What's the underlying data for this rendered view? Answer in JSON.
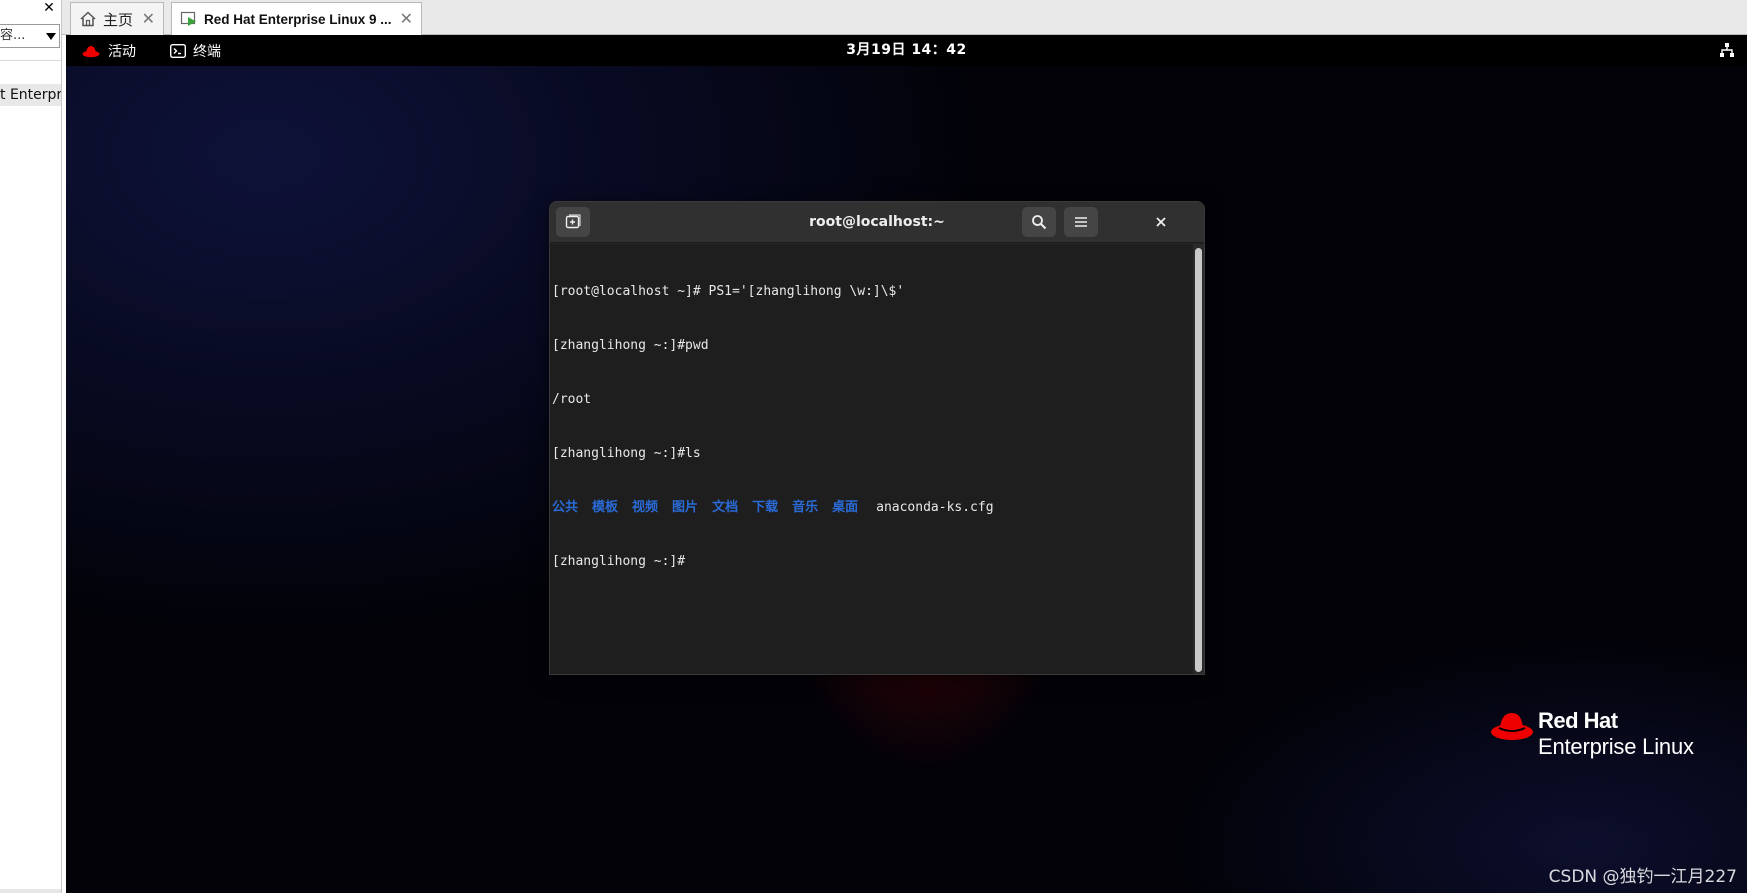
{
  "left_panel": {
    "search_text": "容...",
    "item_label": "t Enterpri"
  },
  "tabs": [
    {
      "label": "主页"
    },
    {
      "label": "Red Hat Enterprise Linux 9 ..."
    }
  ],
  "topbar": {
    "activities": "活动",
    "app_name": "终端",
    "clock": "3月19日 14：42"
  },
  "terminal": {
    "title": "root@localhost:~",
    "lines": [
      "[root@localhost ~]# PS1='[zhanglihong \\w:]\\$'",
      "[zhanglihong ~:]#pwd",
      "/root",
      "[zhanglihong ~:]#ls"
    ],
    "ls_dirs": [
      "公共",
      "模板",
      "视频",
      "图片",
      "文档",
      "下载",
      "音乐",
      "桌面"
    ],
    "ls_file": "anaconda-ks.cfg",
    "prompt": "[zhanglihong ~:]#"
  },
  "branding": {
    "line1": "Red Hat",
    "line2": "Enterprise Linux"
  },
  "watermark": "CSDN @独钓一江月227",
  "colors": {
    "ls_dir": "#2a6ad6",
    "redhat_red": "#ee0000"
  }
}
